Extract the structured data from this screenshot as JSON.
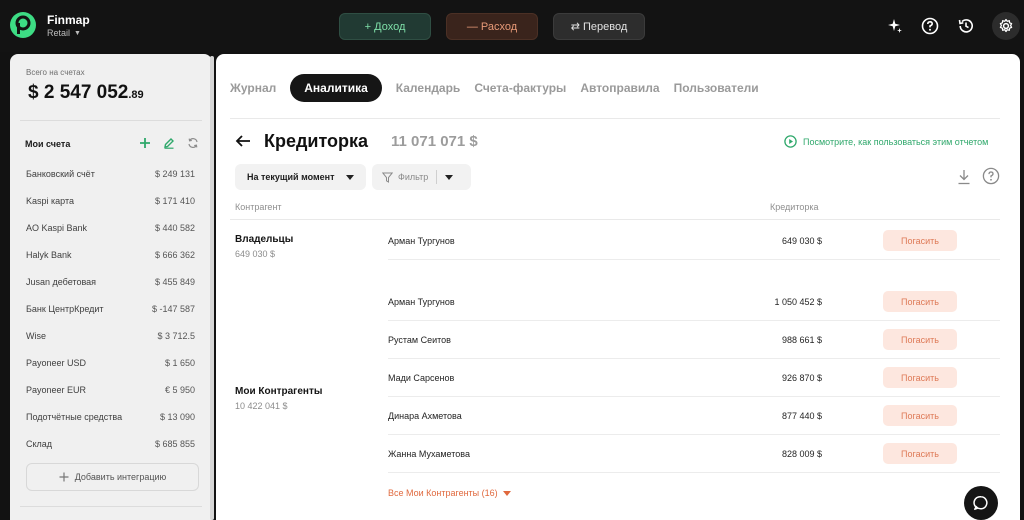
{
  "brand": {
    "name": "Finmap",
    "workspace": "Retail"
  },
  "topbar": {
    "income_label": "+ Доход",
    "expense_label": "— Расход",
    "transfer_label": "⇄ Перевод"
  },
  "sidebar": {
    "total_label": "Всего на счетах",
    "total_amount": "$ 2 547 052",
    "total_cents": ".89",
    "accounts_title": "Мои счета",
    "accounts": [
      {
        "name": "Банковский счёт",
        "amount": "$ 249 131"
      },
      {
        "name": "Kaspi карта",
        "amount": "$ 171 410"
      },
      {
        "name": "AO Kaspi Bank",
        "amount": "$ 440 582"
      },
      {
        "name": "Halyk Bank",
        "amount": "$ 666 362"
      },
      {
        "name": "Jusan дебетовая",
        "amount": "$ 455 849"
      },
      {
        "name": "Банк ЦентрКредит",
        "amount": "$ -147 587"
      },
      {
        "name": "Wise",
        "amount": "$ 3 712.5"
      },
      {
        "name": "Payoneer USD",
        "amount": "$ 1 650"
      },
      {
        "name": "Payoneer EUR",
        "amount": "€ 5 950"
      },
      {
        "name": "Подотчётные средства",
        "amount": "$ 13 090"
      },
      {
        "name": "Склад",
        "amount": "$ 685 855"
      }
    ],
    "add_integration": "Добавить интеграцию"
  },
  "tabs": [
    "Журнал",
    "Аналитика",
    "Календарь",
    "Счета-фактуры",
    "Автоправила",
    "Пользователи"
  ],
  "report": {
    "title": "Кредиторка",
    "total": "11 071 071 $",
    "howto": "Посмотрите, как пользоваться этим отчетом",
    "period_label": "На текущий момент",
    "filter_label": "Фильтр",
    "col_counterparty": "Контрагент",
    "col_credit": "Кредиторка",
    "pay_label": "Погасить",
    "groups": [
      {
        "name": "Владельцы",
        "sum": "649 030 $",
        "rows": [
          {
            "name": "Арман Тургунов",
            "amount": "649 030 $"
          }
        ]
      },
      {
        "name": "Мои Контрагенты",
        "sum": "10 422 041 $",
        "rows": [
          {
            "name": "Арман Тургунов",
            "amount": "1 050 452 $"
          },
          {
            "name": "Рустам Сеитов",
            "amount": "988 661 $"
          },
          {
            "name": "Мади Сарсенов",
            "amount": "926 870 $"
          },
          {
            "name": "Динара Ахметова",
            "amount": "877 440 $"
          },
          {
            "name": "Жанна Мухаметова",
            "amount": "828 009 $"
          }
        ]
      }
    ],
    "more_link": "Все Мои Контрагенты (16)"
  },
  "colors": {
    "accent_green": "#2fa86b",
    "pay_bg": "#fde7df",
    "pay_text": "#de7a57",
    "link_orange": "#e0693e"
  }
}
